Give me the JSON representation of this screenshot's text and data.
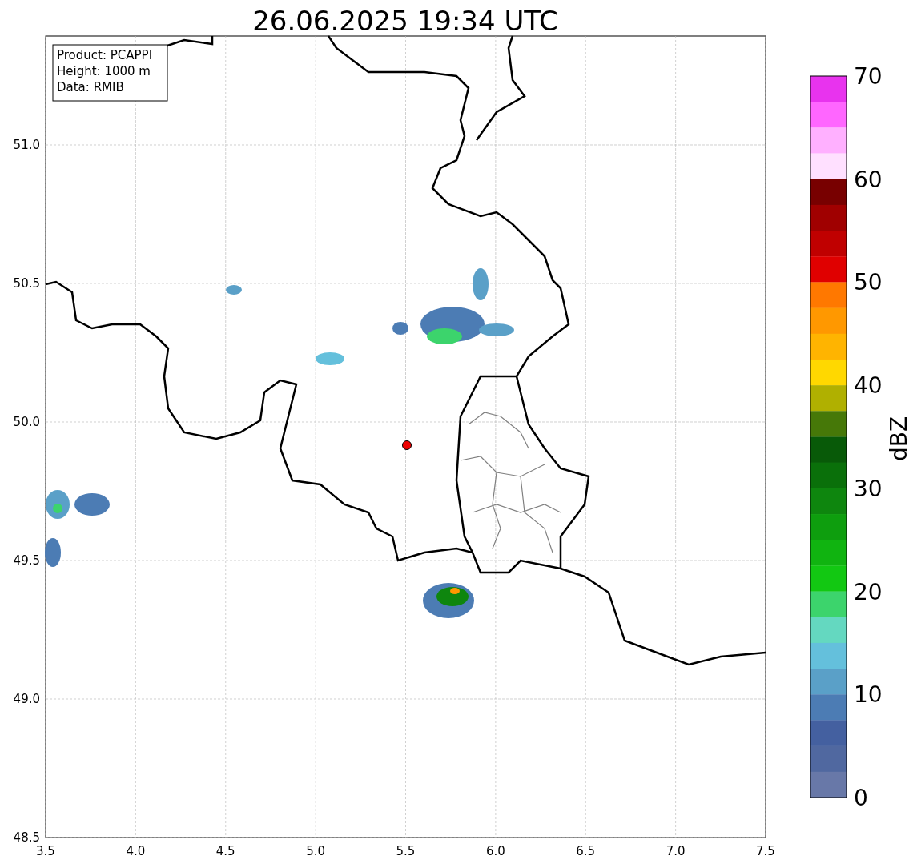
{
  "title": "26.06.2025 19:34 UTC",
  "info_box": [
    "Product: PCAPPI",
    "Height: 1000 m",
    "Data: RMIB"
  ],
  "map": {
    "xticks": [
      "3.5",
      "4.0",
      "4.5",
      "5.0",
      "5.5",
      "6.0",
      "6.5",
      "7.0",
      "7.5"
    ],
    "yticks": [
      "51.0",
      "50.5",
      "50.0",
      "49.5",
      "49.0",
      "48.5"
    ]
  },
  "colorbar": {
    "label": "dBZ",
    "ticks": [
      "70",
      "60",
      "50",
      "40",
      "30",
      "20",
      "10",
      "0"
    ],
    "segments": [
      {
        "color": "#e833ee"
      },
      {
        "color": "#ff66ff"
      },
      {
        "color": "#ffb0ff"
      },
      {
        "color": "#ffe0ff"
      },
      {
        "color": "#780000"
      },
      {
        "color": "#a00000"
      },
      {
        "color": "#c00000"
      },
      {
        "color": "#e00000"
      },
      {
        "color": "#ff7800"
      },
      {
        "color": "#ff9800"
      },
      {
        "color": "#ffb400"
      },
      {
        "color": "#ffd800"
      },
      {
        "color": "#b0b000"
      },
      {
        "color": "#467808"
      },
      {
        "color": "#085a08"
      },
      {
        "color": "#0a700a"
      },
      {
        "color": "#0e860e"
      },
      {
        "color": "#0e9e0e"
      },
      {
        "color": "#10b410"
      },
      {
        "color": "#12c812"
      },
      {
        "color": "#3cd46c"
      },
      {
        "color": "#64d8c0"
      },
      {
        "color": "#64c0dc"
      },
      {
        "color": "#5aa0c8"
      },
      {
        "color": "#4c7cb4"
      },
      {
        "color": "#4460a0"
      },
      {
        "color": "#5068a0"
      },
      {
        "color": "#6878a8"
      }
    ]
  }
}
